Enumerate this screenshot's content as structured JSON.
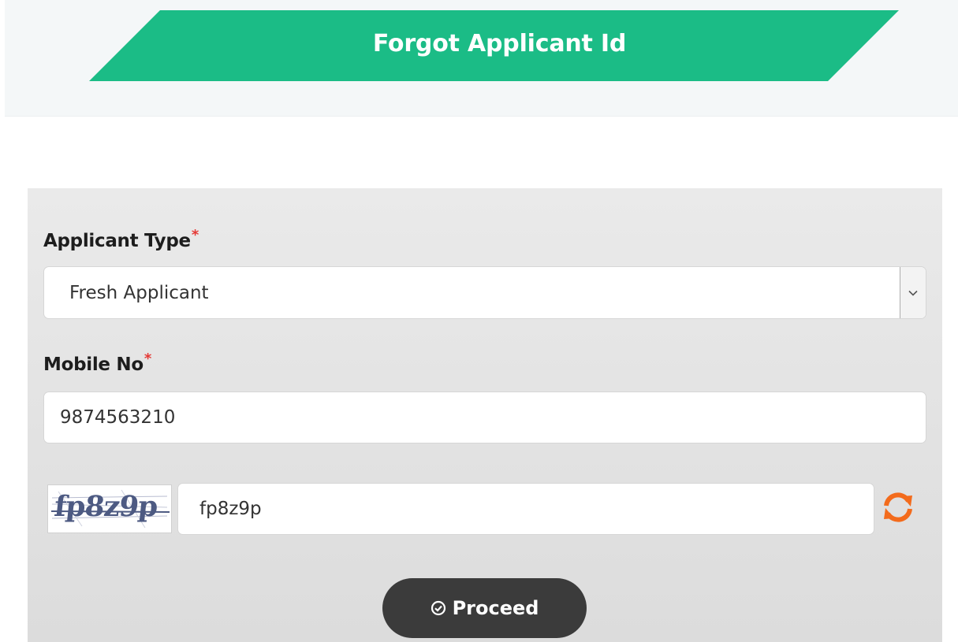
{
  "header": {
    "title": "Forgot Applicant Id",
    "banner_color": "#1bbc86"
  },
  "form": {
    "applicant_type": {
      "label": "Applicant Type",
      "required_mark": "*",
      "selected": "Fresh Applicant"
    },
    "mobile": {
      "label": "Mobile No",
      "required_mark": "*",
      "value": "9874563210"
    },
    "captcha": {
      "image_text": "fp8z9p",
      "value": "fp8z9p",
      "refresh_icon": "refresh-icon",
      "refresh_color": "#f36b1c"
    },
    "proceed": {
      "label": "Proceed",
      "icon": "check-circle-icon"
    }
  }
}
